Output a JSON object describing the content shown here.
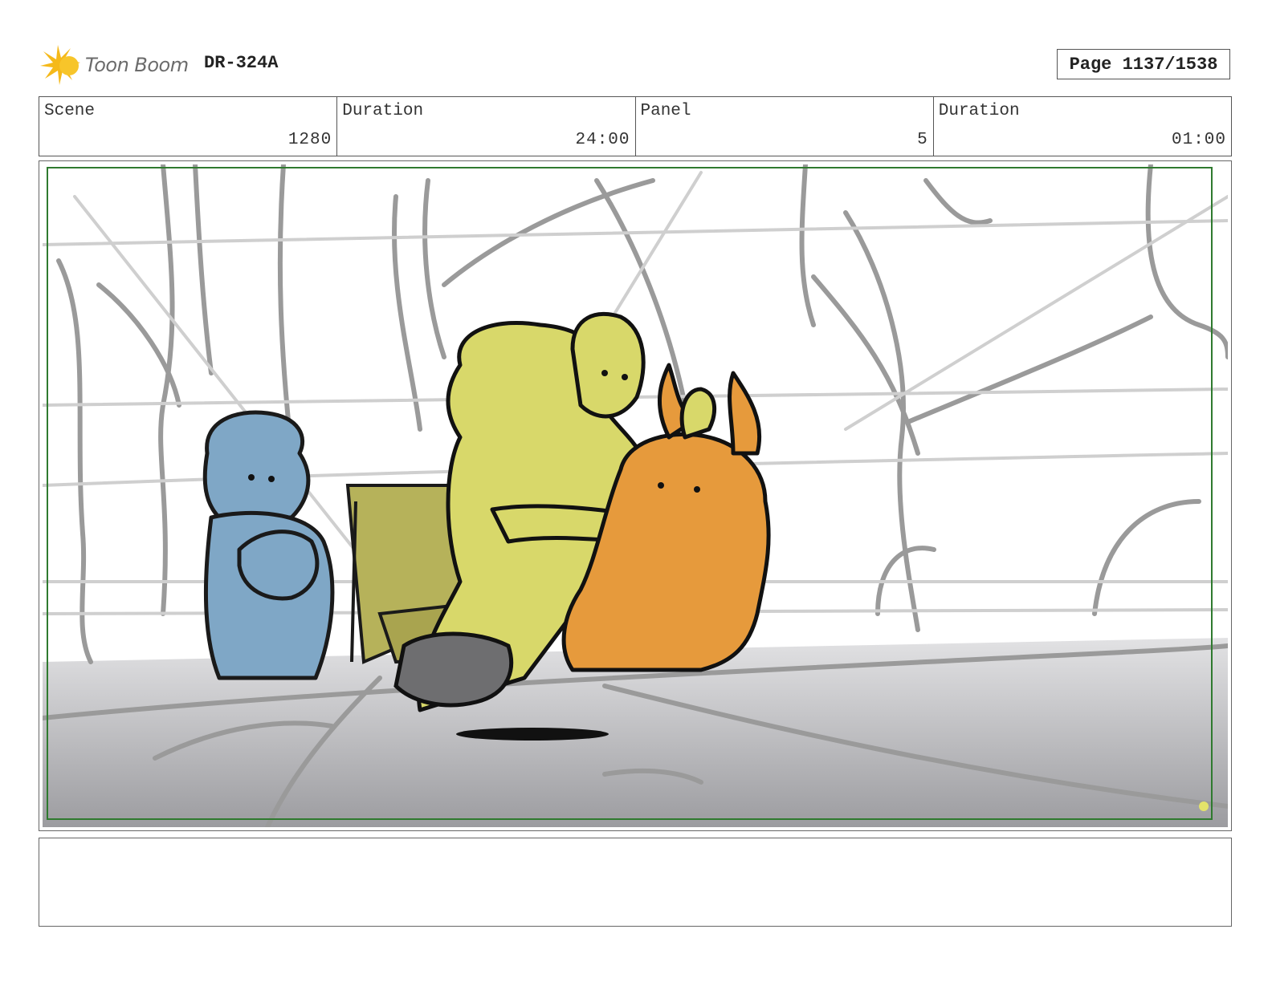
{
  "header": {
    "logo_text": "Toon Boom",
    "production_code": "DR-324A",
    "page_label": "Page 1137/1538"
  },
  "info": {
    "scene_label": "Scene",
    "scene_value": "1280",
    "scene_duration_label": "Duration",
    "scene_duration_value": "24:00",
    "panel_label": "Panel",
    "panel_value": "5",
    "panel_duration_label": "Duration",
    "panel_duration_value": "01:00"
  },
  "colors": {
    "blue_character": "#7fa7c6",
    "yellow_character": "#d8d86a",
    "orange_character": "#e69a3c",
    "bench": "#b6b25a",
    "safe_frame": "#2f7a2f"
  },
  "notes": {
    "text": ""
  }
}
